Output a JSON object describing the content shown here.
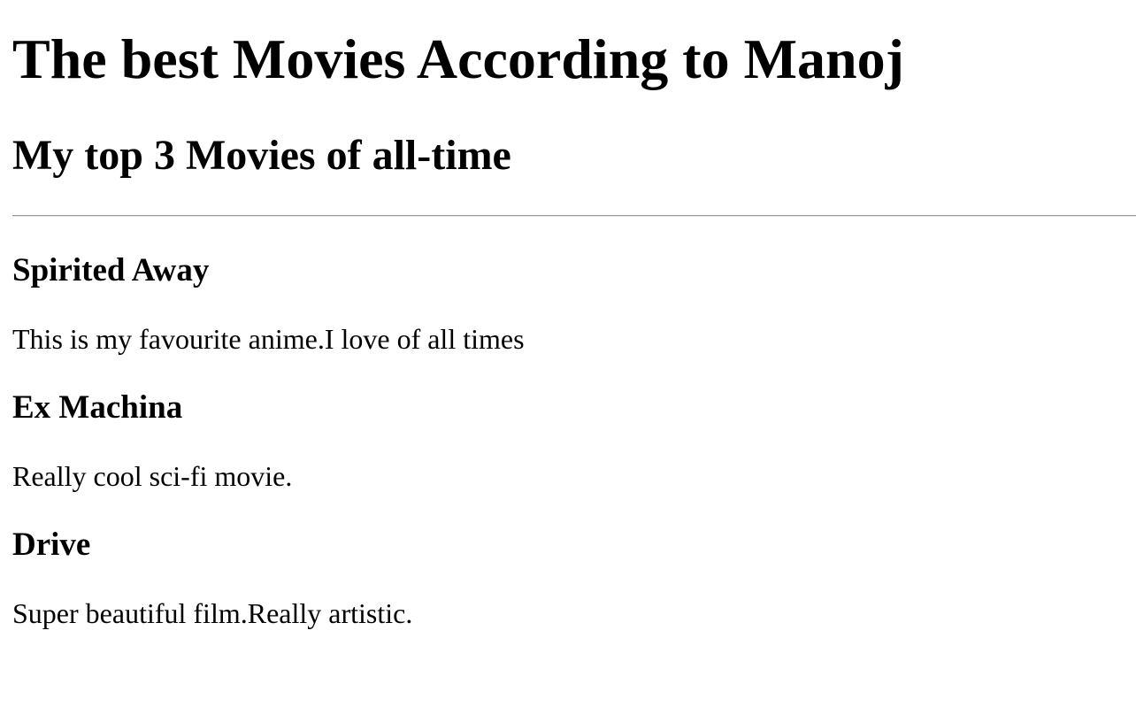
{
  "page": {
    "title": "The best Movies According to Manoj",
    "subtitle": "My top 3 Movies of all-time"
  },
  "movies": [
    {
      "title": "Spirited Away",
      "description": "This is my favourite anime.I love of all times"
    },
    {
      "title": "Ex Machina",
      "description": "Really cool sci-fi movie."
    },
    {
      "title": "Drive",
      "description": "Super beautiful film.Really artistic."
    }
  ]
}
